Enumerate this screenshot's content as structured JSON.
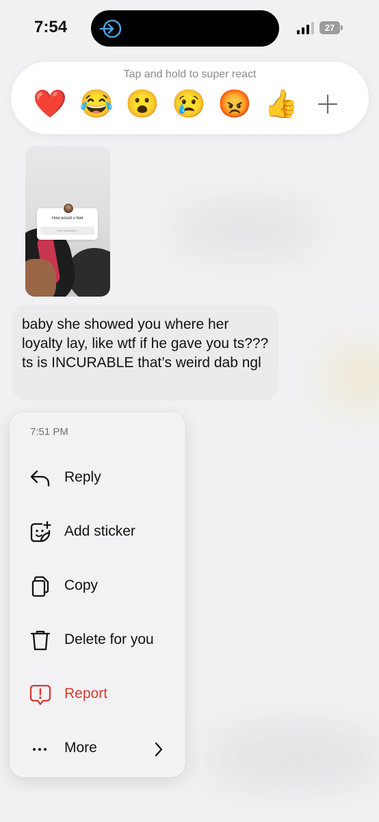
{
  "status_bar": {
    "time": "7:54",
    "battery": "27"
  },
  "reactions": {
    "hint": "Tap and hold to super react",
    "emojis": [
      "❤️",
      "😂",
      "😮",
      "😢",
      "😡",
      "👍"
    ]
  },
  "shared_story": {
    "question": "How would u feel",
    "input_placeholder": "Type something..."
  },
  "message": {
    "text": "baby she showed you where her loyalty lay, like wtf if he gave you ts??? ts is INCURABLE that’s weird dab ngl"
  },
  "context_menu": {
    "timestamp": "7:51 PM",
    "items": [
      {
        "label": "Reply",
        "icon": "reply-icon"
      },
      {
        "label": "Add sticker",
        "icon": "sticker-icon"
      },
      {
        "label": "Copy",
        "icon": "copy-icon"
      },
      {
        "label": "Delete for you",
        "icon": "trash-icon"
      },
      {
        "label": "Report",
        "icon": "report-icon"
      },
      {
        "label": "More",
        "icon": "more-icon"
      }
    ]
  },
  "colors": {
    "danger": "#d63a32",
    "bubble": "#ebebee",
    "background": "#f1f1f3",
    "accent": "#4aa3df"
  }
}
